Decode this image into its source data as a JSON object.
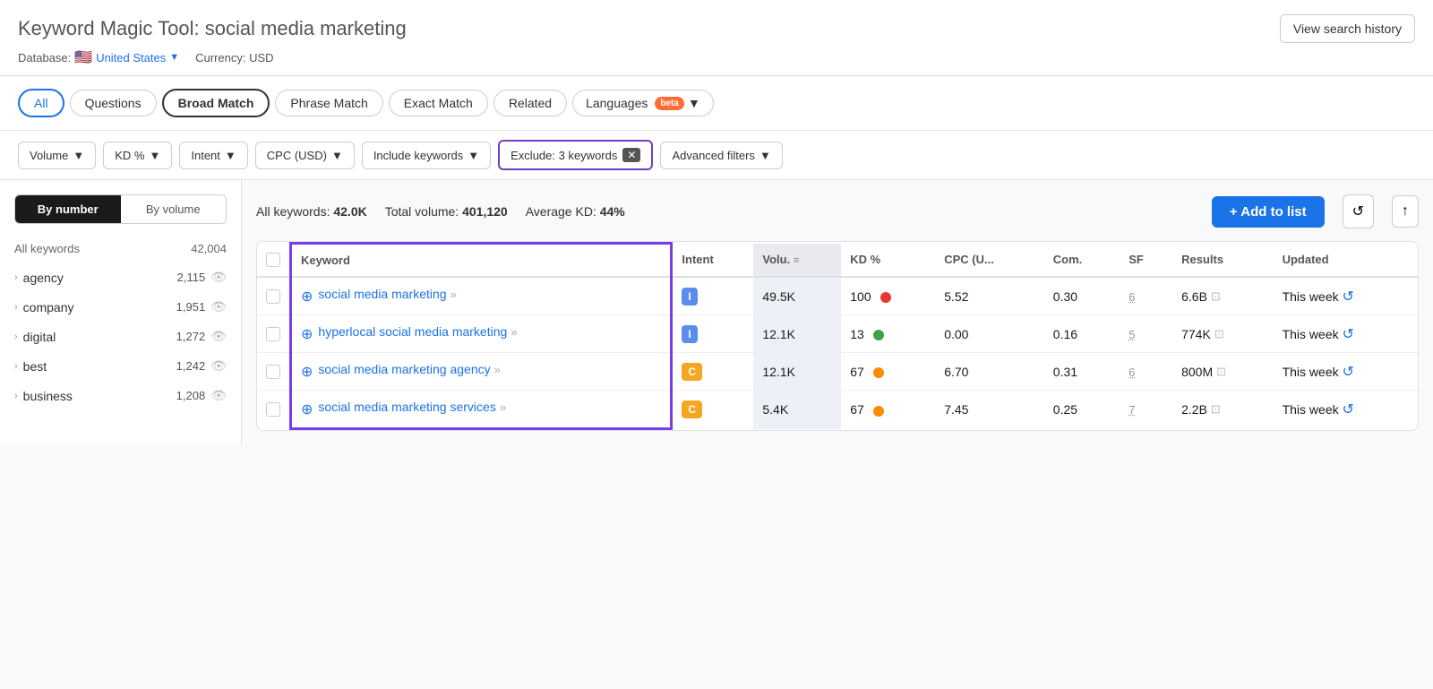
{
  "header": {
    "tool_label": "Keyword Magic Tool:",
    "query": "social media marketing",
    "view_history_label": "View search history",
    "database_label": "Database:",
    "country": "United States",
    "currency_label": "Currency: USD"
  },
  "tabs": {
    "items": [
      {
        "id": "all",
        "label": "All",
        "active": true
      },
      {
        "id": "questions",
        "label": "Questions",
        "active": false
      },
      {
        "id": "broad-match",
        "label": "Broad Match",
        "active": false,
        "selected": true
      },
      {
        "id": "phrase-match",
        "label": "Phrase Match",
        "active": false
      },
      {
        "id": "exact-match",
        "label": "Exact Match",
        "active": false
      },
      {
        "id": "related",
        "label": "Related",
        "active": false
      }
    ],
    "languages_label": "Languages",
    "beta_label": "beta"
  },
  "filters": {
    "volume_label": "Volume",
    "kd_label": "KD %",
    "intent_label": "Intent",
    "cpc_label": "CPC (USD)",
    "include_label": "Include keywords",
    "exclude_label": "Exclude: 3 keywords",
    "advanced_label": "Advanced filters"
  },
  "sidebar": {
    "toggle_by_number": "By number",
    "toggle_by_volume": "By volume",
    "header_keywords": "All keywords",
    "header_count": "42,004",
    "items": [
      {
        "label": "agency",
        "count": "2,115"
      },
      {
        "label": "company",
        "count": "1,951"
      },
      {
        "label": "digital",
        "count": "1,272"
      },
      {
        "label": "best",
        "count": "1,242"
      },
      {
        "label": "business",
        "count": "1,208"
      }
    ]
  },
  "stats": {
    "all_keywords_label": "All keywords:",
    "all_keywords_value": "42.0K",
    "total_volume_label": "Total volume:",
    "total_volume_value": "401,120",
    "avg_kd_label": "Average KD:",
    "avg_kd_value": "44%",
    "add_to_list_label": "+ Add to list"
  },
  "table": {
    "columns": [
      {
        "id": "keyword",
        "label": "Keyword"
      },
      {
        "id": "intent",
        "label": "Intent"
      },
      {
        "id": "volume",
        "label": "Volu."
      },
      {
        "id": "kd",
        "label": "KD %"
      },
      {
        "id": "cpc",
        "label": "CPC (U..."
      },
      {
        "id": "com",
        "label": "Com."
      },
      {
        "id": "sf",
        "label": "SF"
      },
      {
        "id": "results",
        "label": "Results"
      },
      {
        "id": "updated",
        "label": "Updated"
      }
    ],
    "rows": [
      {
        "keyword": "social media marketing",
        "intent": "I",
        "intent_type": "i",
        "volume": "49.5K",
        "kd": "100",
        "kd_dot": "red",
        "cpc": "5.52",
        "com": "0.30",
        "sf": "6",
        "results": "6.6B",
        "updated": "This week"
      },
      {
        "keyword": "hyperlocal social media marketing",
        "intent": "I",
        "intent_type": "i",
        "volume": "12.1K",
        "kd": "13",
        "kd_dot": "green",
        "cpc": "0.00",
        "com": "0.16",
        "sf": "5",
        "results": "774K",
        "updated": "This week"
      },
      {
        "keyword": "social media marketing agency",
        "intent": "C",
        "intent_type": "c",
        "volume": "12.1K",
        "kd": "67",
        "kd_dot": "orange",
        "cpc": "6.70",
        "com": "0.31",
        "sf": "6",
        "results": "800M",
        "updated": "This week"
      },
      {
        "keyword": "social media marketing services",
        "intent": "C",
        "intent_type": "c",
        "volume": "5.4K",
        "kd": "67",
        "kd_dot": "orange",
        "cpc": "7.45",
        "com": "0.25",
        "sf": "7",
        "results": "2.2B",
        "updated": "This week"
      }
    ]
  }
}
